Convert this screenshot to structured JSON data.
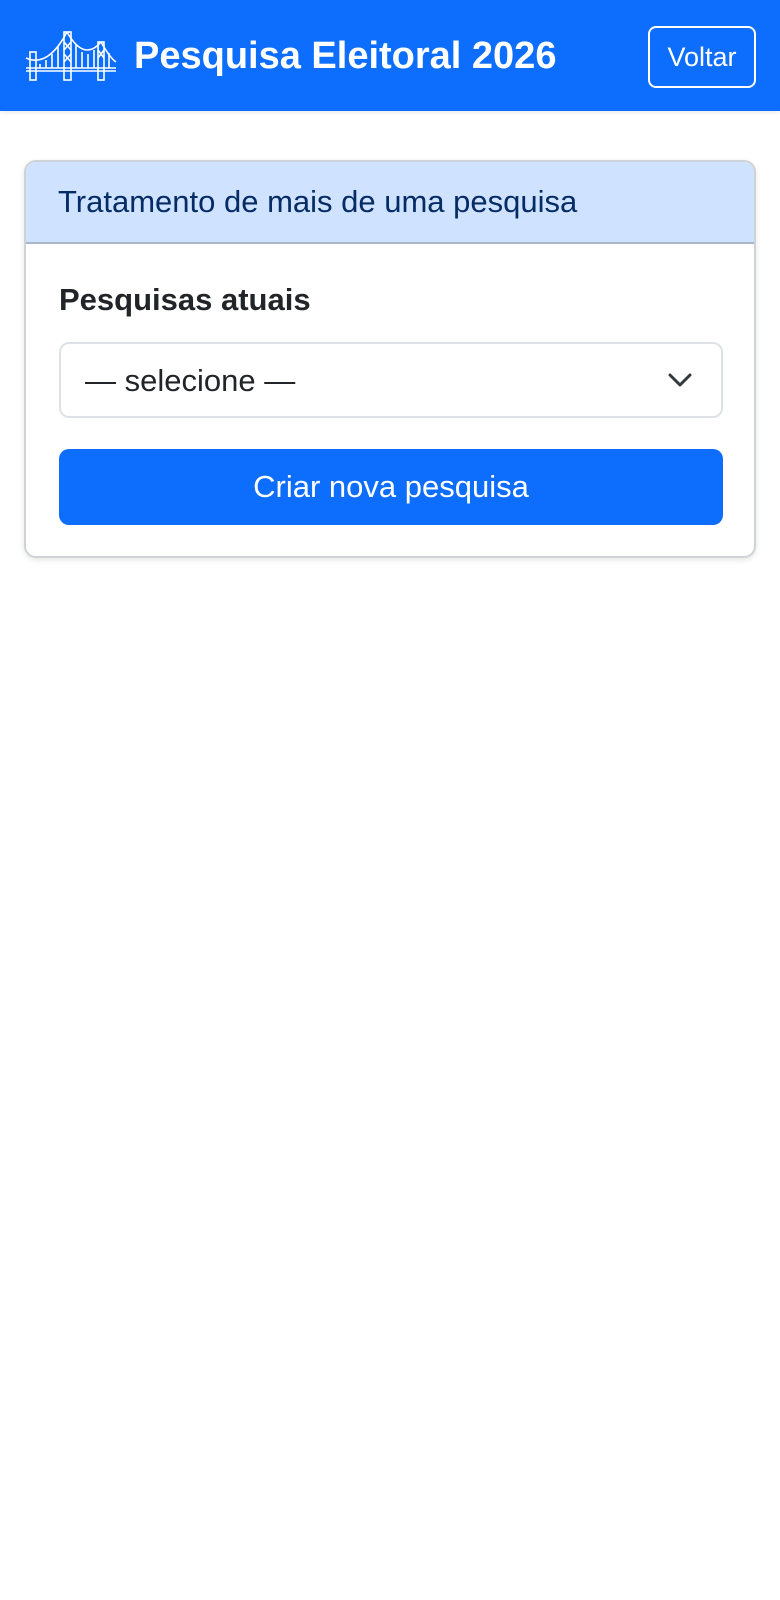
{
  "navbar": {
    "logo_icon": "bridge-icon",
    "title": "Pesquisa Eleitoral 2026",
    "back_label": "Voltar",
    "color": "#0d6efd"
  },
  "card": {
    "header_title": "Tratamento de mais de uma pesquisa",
    "field_label": "Pesquisas atuais",
    "select": {
      "selected": "— selecione —",
      "icon": "chevron-down-icon"
    },
    "create_button_label": "Criar nova pesquisa",
    "header_bg": "#cfe2ff",
    "header_text_color": "#052c65"
  }
}
